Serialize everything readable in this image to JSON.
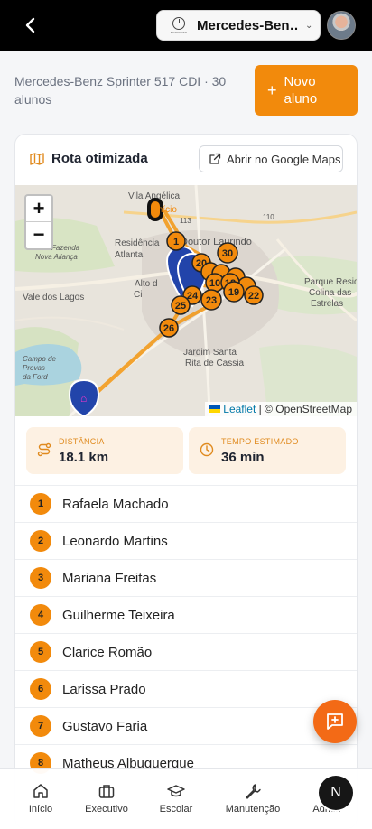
{
  "header": {
    "vehicle_select": "Mercedes-Ben…",
    "brand_logo_text": "MERCEDES"
  },
  "page": {
    "subtitle": "Mercedes-Benz Sprinter 517 CDI · 30 alunos",
    "new_button_label": "Novo aluno"
  },
  "route_card": {
    "title": "Rota otimizada",
    "google_maps_button": "Abrir no Google Maps",
    "map": {
      "labels": [
        "Vila Angélica",
        "Início",
        "Doutor Laurindo",
        "Residência",
        "Atlanta",
        "Alto d",
        "Ci",
        "Vale dos Lagos",
        "Parque Reside",
        "Colina das",
        "Estrelas",
        "Jardim Santa",
        "Rita de Cassia",
        "Campo de",
        "Provas",
        "da Ford",
        "Fazenda",
        "Nova Aliança",
        "110",
        "113"
      ],
      "zoom_in": "+",
      "zoom_out": "−",
      "attribution_leaflet": "Leaflet",
      "attribution_rest": "| © OpenStreetMap",
      "markers": [
        "1",
        "30",
        "20",
        "10",
        "19",
        "22",
        "24",
        "23",
        "25",
        "26",
        "18"
      ]
    },
    "stats": {
      "distance_label": "DISTÂNCIA",
      "distance_value": "18.1 km",
      "time_label": "TEMPO ESTIMADO",
      "time_value": "36 min"
    },
    "students": [
      {
        "n": "1",
        "name": "Rafaela Machado"
      },
      {
        "n": "2",
        "name": "Leonardo Martins"
      },
      {
        "n": "3",
        "name": "Mariana Freitas"
      },
      {
        "n": "4",
        "name": "Guilherme Teixeira"
      },
      {
        "n": "5",
        "name": "Clarice Romão"
      },
      {
        "n": "6",
        "name": "Larissa Prado"
      },
      {
        "n": "7",
        "name": "Gustavo Faria"
      },
      {
        "n": "8",
        "name": "Matheus Albuquerque"
      }
    ]
  },
  "bottom_nav": {
    "items": [
      "Início",
      "Executivo",
      "Escolar",
      "Manutenção",
      "Admin"
    ],
    "admin_initial": "N"
  },
  "colors": {
    "accent": "#f28a0c",
    "fab": "#f36a16",
    "route_line": "#f29a1c",
    "marker_blue": "#2244aa"
  }
}
